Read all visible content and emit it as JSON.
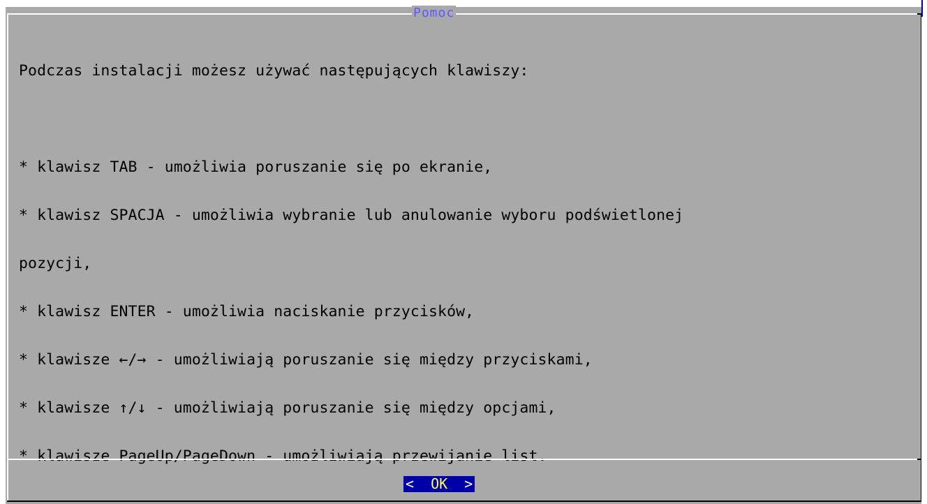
{
  "dialog": {
    "title": "Pomoc",
    "lines": [
      "Podczas instalacji możesz używać następujących klawiszy:",
      "",
      "* klawisz TAB - umożliwia poruszanie się po ekranie,",
      "* klawisz SPACJA - umożliwia wybranie lub anulowanie wyboru podświetlonej",
      "pozycji,",
      "* klawisz ENTER - umożliwia naciskanie przycisków,",
      "* klawisze ←/→ - umożliwiają poruszanie się między przyciskami,",
      "* klawisze ↑/↓ - umożliwiają poruszanie się między opcjami,",
      "* klawisze PageUp/PageDown - umożliwiają przewijanie list."
    ]
  },
  "buttons": {
    "ok_left": "<  ",
    "ok_hot": "OK",
    "ok_right": "  >"
  },
  "colors": {
    "dialog_background": "#a9a9a9",
    "title_text": "#5a5aff",
    "button_background": "#0000a8",
    "button_hotkey": "#ffff55"
  }
}
